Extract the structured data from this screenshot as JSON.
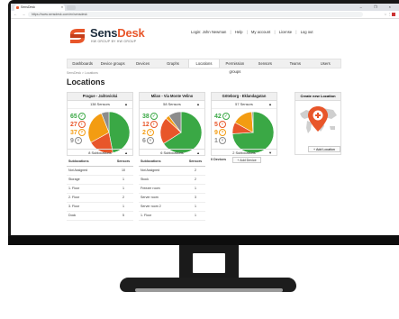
{
  "browser": {
    "tab_title": "SensDesk",
    "tab_close": "×",
    "url": "https://www.sensdesk.com/en/sensdesk",
    "window_controls": "– ❐ ×",
    "nav_symbols": "← → C"
  },
  "brand": {
    "name_part1": "Sens",
    "name_part2": "Desk",
    "tagline": "HW GROUP BY HW GROUP",
    "accent_color": "#e8562a"
  },
  "top_links": {
    "login": "Login: John Newman",
    "help": "Help",
    "my_account": "My account",
    "license": "License",
    "logout": "Log out",
    "sep": "|"
  },
  "menu": [
    "Dashboards",
    "Device groups",
    "Devices",
    "Graphs",
    "Locations",
    "Permission groups",
    "Sensors",
    "Teams",
    "Users"
  ],
  "menu_active": 4,
  "breadcrumb": "SensDesk > Locations",
  "page_title": "Locations",
  "locations": [
    {
      "name": "Prague - Jaštovická",
      "sensors_label": "138 Sensors",
      "counts": {
        "ok": "65",
        "warn": "27",
        "alarm": "37",
        "off": "9"
      },
      "pie": {
        "ok": 0.47,
        "warn": 0.2,
        "alarm": 0.27,
        "off": 0.06
      },
      "sublocations_label": "8 Sublocations",
      "sub_header": {
        "name": "Sublocations",
        "sensors": "Sensors"
      },
      "subs": [
        {
          "name": "Not Assigned",
          "sensors": "10"
        },
        {
          "name": "Storage",
          "sensors": "1"
        },
        {
          "name": "1. Floor",
          "sensors": "1"
        },
        {
          "name": "2. Floor",
          "sensors": "2"
        },
        {
          "name": "3. Floor",
          "sensors": "1"
        },
        {
          "name": "Dock",
          "sensors": "5"
        }
      ]
    },
    {
      "name": "Milan - Via Monte Velino",
      "sensors_label": "58 Sensors",
      "counts": {
        "ok": "38",
        "warn": "12",
        "alarm": "2",
        "off": "6"
      },
      "pie": {
        "ok": 0.66,
        "warn": 0.21,
        "alarm": 0.03,
        "off": 0.1
      },
      "sublocations_label": "6 Sublocations",
      "sub_header": {
        "name": "Sublocations",
        "sensors": "Sensors"
      },
      "subs": [
        {
          "name": "Not Assigned",
          "sensors": "2"
        },
        {
          "name": "Stock",
          "sensors": "2"
        },
        {
          "name": "Freezer room",
          "sensors": "1"
        },
        {
          "name": "Server room",
          "sensors": "3"
        },
        {
          "name": "Server room 2",
          "sensors": "1"
        },
        {
          "name": "1. Floor",
          "sensors": "1"
        }
      ]
    },
    {
      "name": "Göteborg - Eklandagatan",
      "sensors_label": "57 Sensors",
      "counts": {
        "ok": "42",
        "warn": "5",
        "alarm": "9",
        "off": "1"
      },
      "pie": {
        "ok": 0.74,
        "warn": 0.09,
        "alarm": 0.16,
        "off": 0.01
      },
      "sublocations_label": "2 Sublocations",
      "devices_label": "0 Devices",
      "add_device": "+ Add Device"
    }
  ],
  "create_panel": {
    "title": "Create new Location",
    "add_button": "+ Add Location"
  },
  "colors": {
    "ok": "#3aa845",
    "warn": "#e8562a",
    "alarm": "#f39c12",
    "off": "#8c8c8c"
  }
}
